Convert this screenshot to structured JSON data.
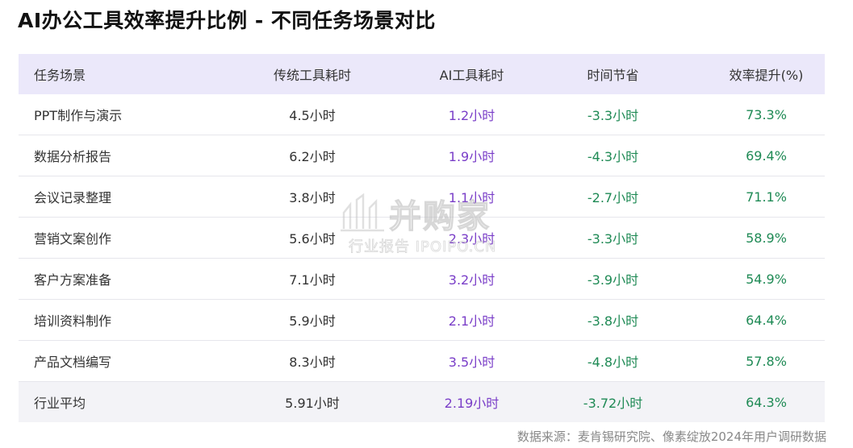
{
  "title": "AI办公工具效率提升比例 - 不同任务场景对比",
  "table": {
    "headers": [
      "任务场景",
      "传统工具耗时",
      "AI工具耗时",
      "时间节省",
      "效率提升(%)"
    ],
    "rows": [
      {
        "scene": "PPT制作与演示",
        "traditional": "4.5小时",
        "ai": "1.2小时",
        "saved": "-3.3小时",
        "efficiency": "73.3%"
      },
      {
        "scene": "数据分析报告",
        "traditional": "6.2小时",
        "ai": "1.9小时",
        "saved": "-4.3小时",
        "efficiency": "69.4%"
      },
      {
        "scene": "会议记录整理",
        "traditional": "3.8小时",
        "ai": "1.1小时",
        "saved": "-2.7小时",
        "efficiency": "71.1%"
      },
      {
        "scene": "营销文案创作",
        "traditional": "5.6小时",
        "ai": "2.3小时",
        "saved": "-3.3小时",
        "efficiency": "58.9%"
      },
      {
        "scene": "客户方案准备",
        "traditional": "7.1小时",
        "ai": "3.2小时",
        "saved": "-3.9小时",
        "efficiency": "54.9%"
      },
      {
        "scene": "培训资料制作",
        "traditional": "5.9小时",
        "ai": "2.1小时",
        "saved": "-3.8小时",
        "efficiency": "64.4%"
      },
      {
        "scene": "产品文档编写",
        "traditional": "8.3小时",
        "ai": "3.5小时",
        "saved": "-4.8小时",
        "efficiency": "57.8%"
      }
    ],
    "average": {
      "scene": "行业平均",
      "traditional": "5.91小时",
      "ai": "2.19小时",
      "saved": "-3.72小时",
      "efficiency": "64.3%"
    }
  },
  "watermark": {
    "main": "并购家",
    "sub": "行业报告 IPOIPO.CN"
  },
  "source": "数据来源：麦肯锡研究院、像素绽放2024年用户调研数据",
  "colors": {
    "header_bg": "#ebe8fa",
    "ai_text": "#7a3ec8",
    "saved_text": "#1f8a55",
    "average_bg": "#f3f3f7"
  }
}
